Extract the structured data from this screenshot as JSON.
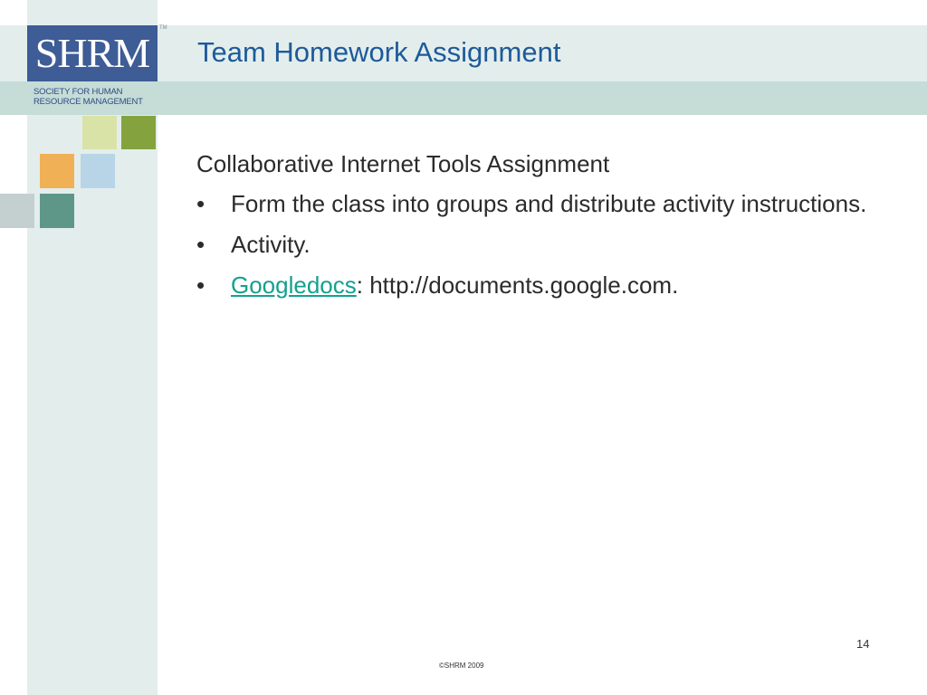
{
  "slide": {
    "title": "Team Homework Assignment",
    "logo": {
      "mark": "SHRM",
      "trademark": "TM",
      "subtitle_line1": "SOCIETY FOR HUMAN",
      "subtitle_line2": "RESOURCE MANAGEMENT"
    },
    "intro": "Collaborative Internet Tools Assignment",
    "bullets": [
      {
        "text": "Form the class into groups and distribute activity instructions."
      },
      {
        "text": "Activity."
      },
      {
        "link_text": "Googledocs",
        "text": ": http://documents.google.com."
      }
    ],
    "bullet_symbol": "•",
    "page_number": "14",
    "copyright": "©SHRM 2009"
  },
  "colors": {
    "title": "#1e5a9a",
    "logo_bg": "#3e5c95",
    "band_light": "#e3eeec",
    "band_mid": "#c5dcd7",
    "link": "#13a08f",
    "squares": [
      "#d9e3a7",
      "#84a33f",
      "#f0b056",
      "#b7d5e6",
      "#c4cfcf",
      "#5e9788"
    ]
  }
}
